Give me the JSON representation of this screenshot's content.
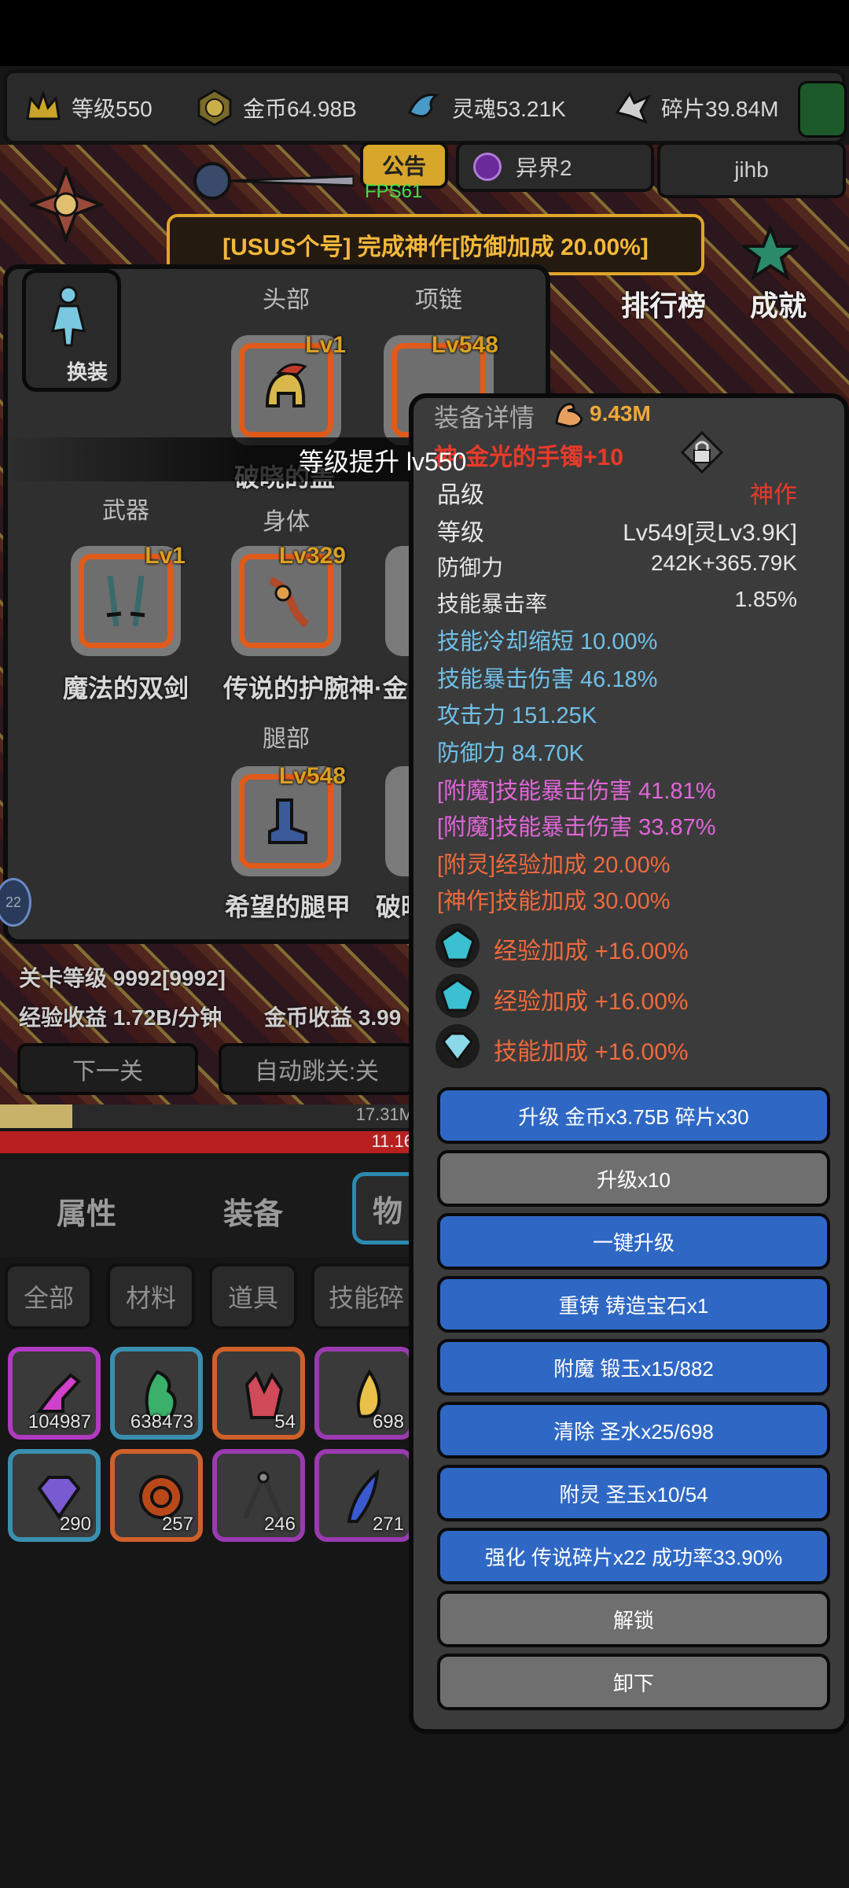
{
  "resources": [
    {
      "icon": "crown-icon",
      "label": "等级550"
    },
    {
      "icon": "gold-coin-icon",
      "label": "金币64.98B"
    },
    {
      "icon": "soul-icon",
      "label": "灵魂53.21K"
    },
    {
      "icon": "fragment-icon",
      "label": "碎片39.84M"
    }
  ],
  "top": {
    "notice": "公告",
    "fps": "FPS61",
    "world": "异界2",
    "user": "jihb",
    "ranking": "排行榜",
    "achievement": "成就"
  },
  "announcement": "[USUS个号] 完成神作[防御加成 20.00%]",
  "equipment": {
    "change_label": "换装",
    "slots": {
      "head": {
        "label": "头部",
        "lv": "Lv1",
        "name": "破晓的盖"
      },
      "necklace": {
        "label": "项链",
        "lv": "Lv548"
      },
      "weapon": {
        "label": "武器",
        "lv": "Lv1",
        "name": "魔法的双剑"
      },
      "body": {
        "label": "身体",
        "lv": "Lv329",
        "name": "传说的护腕神·金"
      },
      "legs": {
        "label": "腿部",
        "lv": "Lv548",
        "name": "希望的腿甲"
      },
      "partial_name": "破晓"
    }
  },
  "levelup_text": "等级提升 lv550",
  "stage": {
    "level": "关卡等级 9992[9992]",
    "exp_income": "经验收益 1.72B/分钟",
    "gold_income": "金币收益 3.99",
    "next_button": "下一关",
    "auto_skip": "自动跳关:关",
    "exp_bar": "17.31M",
    "hp_bar": "11.16"
  },
  "main_tabs": [
    "属性",
    "装备",
    "物"
  ],
  "filters": [
    "全部",
    "材料",
    "道具",
    "技能碎"
  ],
  "inventory": [
    {
      "count": "104987",
      "color": "#b03ac0",
      "icon": "purple-shoe-icon"
    },
    {
      "count": "638473",
      "color": "#3a8fb0",
      "icon": "green-herb-icon"
    },
    {
      "count": "54",
      "color": "#d0602a",
      "icon": "red-crystal-icon"
    },
    {
      "count": "698",
      "color": "#9a3ab0",
      "icon": "yellow-drop-icon"
    },
    {
      "count": "290",
      "color": "#3a8fb0",
      "icon": "purple-diamond-icon"
    },
    {
      "count": "257",
      "color": "#d0602a",
      "icon": "orange-rune-icon"
    },
    {
      "count": "246",
      "color": "#9a3ab0",
      "icon": "compass-icon"
    },
    {
      "count": "271",
      "color": "#9a3ab0",
      "icon": "blue-feather-icon"
    }
  ],
  "detail": {
    "title": "装备详情",
    "power": "9.43M",
    "item_name": "神·金光的手镯+10",
    "rows": [
      {
        "k": "品级",
        "v": "神作"
      },
      {
        "k": "等级",
        "v": "Lv549[灵Lv3.9K]"
      },
      {
        "k": "防御力",
        "v": "242K+365.79K"
      },
      {
        "k": "技能暴击率",
        "v": "1.85%"
      }
    ],
    "attrs": [
      {
        "text": "技能冷却缩短 10.00%",
        "color": "#6fc0e8"
      },
      {
        "text": "技能暴击伤害 46.18%",
        "color": "#6fc0e8"
      },
      {
        "text": "攻击力 151.25K",
        "color": "#6fc0e8"
      },
      {
        "text": "防御力 84.70K",
        "color": "#6fc0e8"
      },
      {
        "text": "[附魔]技能暴击伤害 41.81%",
        "color": "#e066d8"
      },
      {
        "text": "[附魔]技能暴击伤害 33.87%",
        "color": "#e066d8"
      },
      {
        "text": "[附灵]经验加成 20.00%",
        "color": "#f06a3c"
      },
      {
        "text": "[神作]技能加成 30.00%",
        "color": "#f06a3c"
      }
    ],
    "gems": [
      {
        "text": "经验加成 +16.00%",
        "icon": "cyan-pentagon-gem-icon"
      },
      {
        "text": "经验加成 +16.00%",
        "icon": "cyan-pentagon-gem-icon"
      },
      {
        "text": "技能加成 +16.00%",
        "icon": "diamond-gem-icon"
      }
    ],
    "buttons": [
      {
        "label": "升级 金币x3.75B 碎片x30",
        "style": "blue"
      },
      {
        "label": "升级x10",
        "style": "gray"
      },
      {
        "label": "一键升级",
        "style": "blue"
      },
      {
        "label": "重铸 铸造宝石x1",
        "style": "blue"
      },
      {
        "label": "附魔 锻玉x15/882",
        "style": "blue"
      },
      {
        "label": "清除 圣水x25/698",
        "style": "blue"
      },
      {
        "label": "附灵 圣玉x10/54",
        "style": "blue"
      },
      {
        "label": "强化 传说碎片x22 成功率33.90%",
        "style": "blue"
      },
      {
        "label": "解锁",
        "style": "gray"
      },
      {
        "label": "卸下",
        "style": "gray"
      }
    ]
  },
  "side_badge": "22"
}
